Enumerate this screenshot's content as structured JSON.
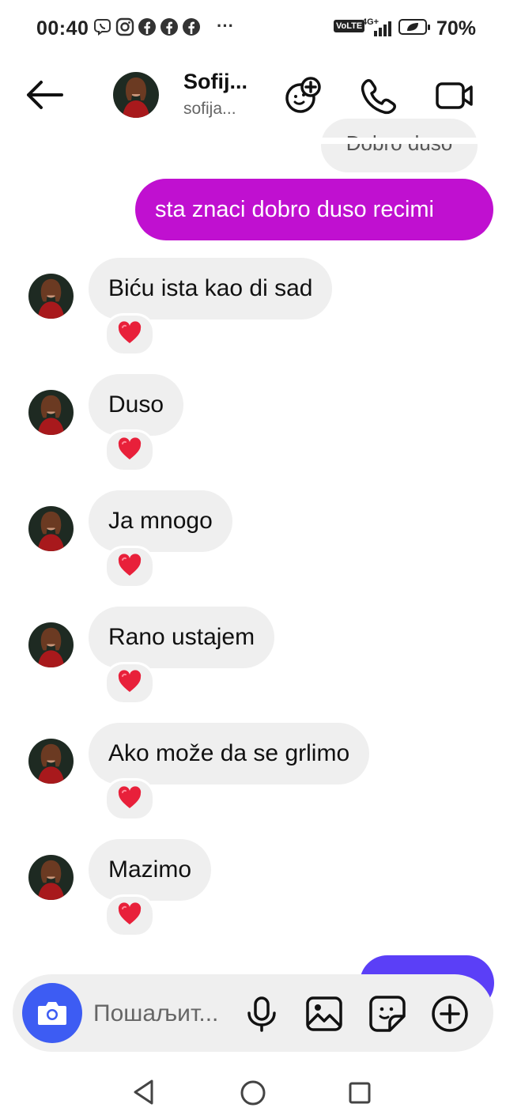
{
  "status_bar": {
    "time": "00:40",
    "volte": "VoLTE",
    "network": "4G+",
    "battery": "70%",
    "more": "···"
  },
  "header": {
    "name": "Sofij...",
    "username": "sofija..."
  },
  "previous_message": "Dobro duso",
  "sent_message": "sta znaci dobro duso recimi",
  "messages": [
    {
      "text": "Biću ista kao di sad",
      "reaction": "❤️"
    },
    {
      "text": "Duso",
      "reaction": "❤️"
    },
    {
      "text": "Ja mnogo",
      "reaction": "❤️"
    },
    {
      "text": "Rano ustajem",
      "reaction": "❤️"
    },
    {
      "text": "Ako može da se grlimo",
      "reaction": "❤️"
    },
    {
      "text": "Mazimo",
      "reaction": "❤️"
    }
  ],
  "composer": {
    "placeholder": "Пошаљит..."
  },
  "colors": {
    "sent_bubble": "#c010d0",
    "received_bubble": "#efefef",
    "camera_button": "#3d5cf3",
    "partial_sent_bubble": "#5b3ff7"
  }
}
